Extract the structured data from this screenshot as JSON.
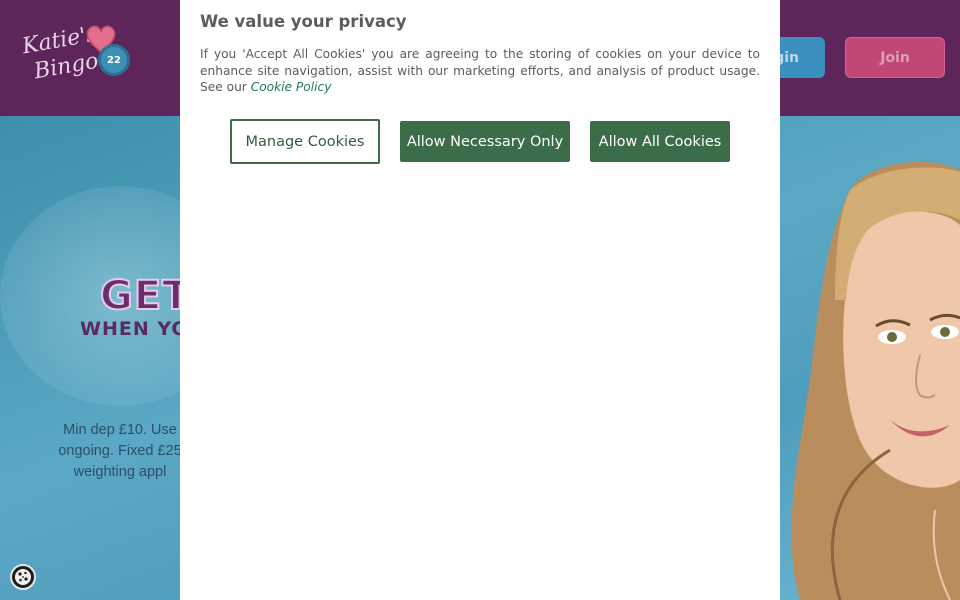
{
  "header": {
    "logo": {
      "line1": "Katie's",
      "line2": "Bingo",
      "ball_number": "22"
    },
    "login_label": "gin",
    "join_label": "Join"
  },
  "hero": {
    "headline": "GET",
    "subline": "WHEN YOU",
    "terms": [
      "Min dep £10. Use",
      "ongoing. Fixed £25",
      "weighting appl"
    ]
  },
  "modal": {
    "title": "We value your privacy",
    "body": "If you 'Accept All Cookies' you are agreeing to the storing of cookies on your device to enhance site navigation, assist with our marketing efforts, and analysis of product usage. See our",
    "policy_link": "Cookie Policy",
    "buttons": {
      "manage": "Manage Cookies",
      "necessary": "Allow Necessary Only",
      "all": "Allow All Cookies"
    }
  },
  "colors": {
    "header_bg": "#5d2559",
    "modal_button_green": "#3b6d49",
    "join_pink": "#c14777",
    "login_blue": "#3a8fbf"
  },
  "icons": [
    "logo-heart-icon",
    "bingo-ball-icon",
    "cookie-icon"
  ]
}
